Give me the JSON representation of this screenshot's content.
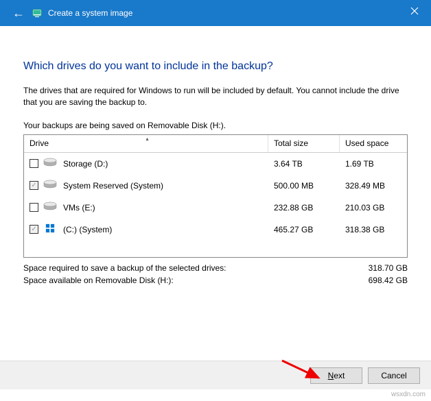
{
  "titlebar": {
    "title": "Create a system image"
  },
  "heading": "Which drives do you want to include in the backup?",
  "description": "The drives that are required for Windows to run will be included by default. You cannot include the drive that you are saving the backup to.",
  "saving_to": "Your backups are being saved on Removable Disk (H:).",
  "table": {
    "headers": {
      "drive": "Drive",
      "total": "Total size",
      "used": "Used space"
    },
    "rows": [
      {
        "checked": false,
        "disabled": false,
        "icon": "hdd",
        "name": "Storage (D:)",
        "total": "3.64 TB",
        "used": "1.69 TB"
      },
      {
        "checked": true,
        "disabled": true,
        "icon": "hdd",
        "name": "System Reserved (System)",
        "total": "500.00 MB",
        "used": "328.49 MB"
      },
      {
        "checked": false,
        "disabled": false,
        "icon": "hdd",
        "name": "VMs (E:)",
        "total": "232.88 GB",
        "used": "210.03 GB"
      },
      {
        "checked": true,
        "disabled": true,
        "icon": "win",
        "name": "(C:) (System)",
        "total": "465.27 GB",
        "used": "318.38 GB"
      }
    ]
  },
  "summary": {
    "required_label": "Space required to save a backup of the selected drives:",
    "required_value": "318.70 GB",
    "available_label": "Space available on Removable Disk (H:):",
    "available_value": "698.42 GB"
  },
  "buttons": {
    "next": "Next",
    "cancel": "Cancel"
  },
  "watermark": "wsxdn.com"
}
